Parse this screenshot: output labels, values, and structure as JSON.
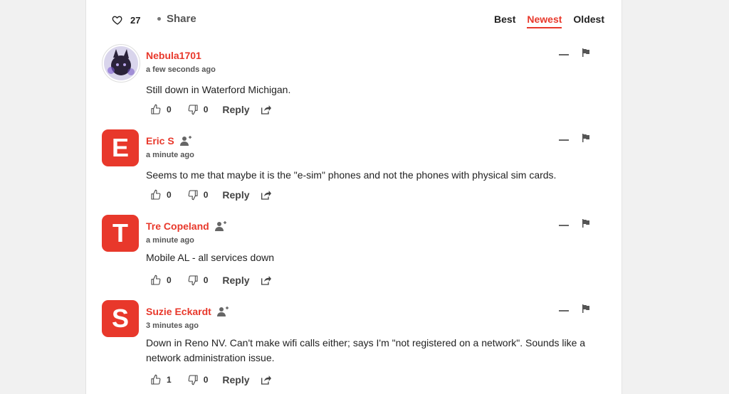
{
  "header": {
    "like_count": "27",
    "share_label": "Share",
    "sort": [
      "Best",
      "Newest",
      "Oldest"
    ],
    "active_sort": "Newest"
  },
  "comments": [
    {
      "author": "Nebula1701",
      "time": "a few seconds ago",
      "text": "Still down in Waterford Michigan.",
      "likes": "0",
      "dislikes": "0",
      "reply": "Reply",
      "avatar_letter": "",
      "avatar_type": "image",
      "follow_icon": false
    },
    {
      "author": "Eric S",
      "time": "a minute ago",
      "text": "Seems to me that maybe it is the \"e-sim\" phones and not the phones with physical sim cards.",
      "likes": "0",
      "dislikes": "0",
      "reply": "Reply",
      "avatar_letter": "E",
      "avatar_type": "letter",
      "follow_icon": true
    },
    {
      "author": "Tre Copeland",
      "time": "a minute ago",
      "text": "Mobile AL - all services down",
      "likes": "0",
      "dislikes": "0",
      "reply": "Reply",
      "avatar_letter": "T",
      "avatar_type": "letter",
      "follow_icon": true
    },
    {
      "author": "Suzie Eckardt",
      "time": "3 minutes ago",
      "text": "Down in Reno NV. Can't make wifi calls either; says I'm \"not registered on a network\". Sounds like a network administration issue.",
      "likes": "1",
      "dislikes": "0",
      "reply": "Reply",
      "avatar_letter": "S",
      "avatar_type": "letter",
      "follow_icon": true
    }
  ],
  "colors": {
    "accent": "#e8382b",
    "text": "#222222",
    "muted": "#555555"
  },
  "icons": [
    "heart-icon",
    "thumbs-up-icon",
    "thumbs-down-icon",
    "share-arrow-icon",
    "flag-icon",
    "minimize-icon",
    "follow-user-icon"
  ]
}
